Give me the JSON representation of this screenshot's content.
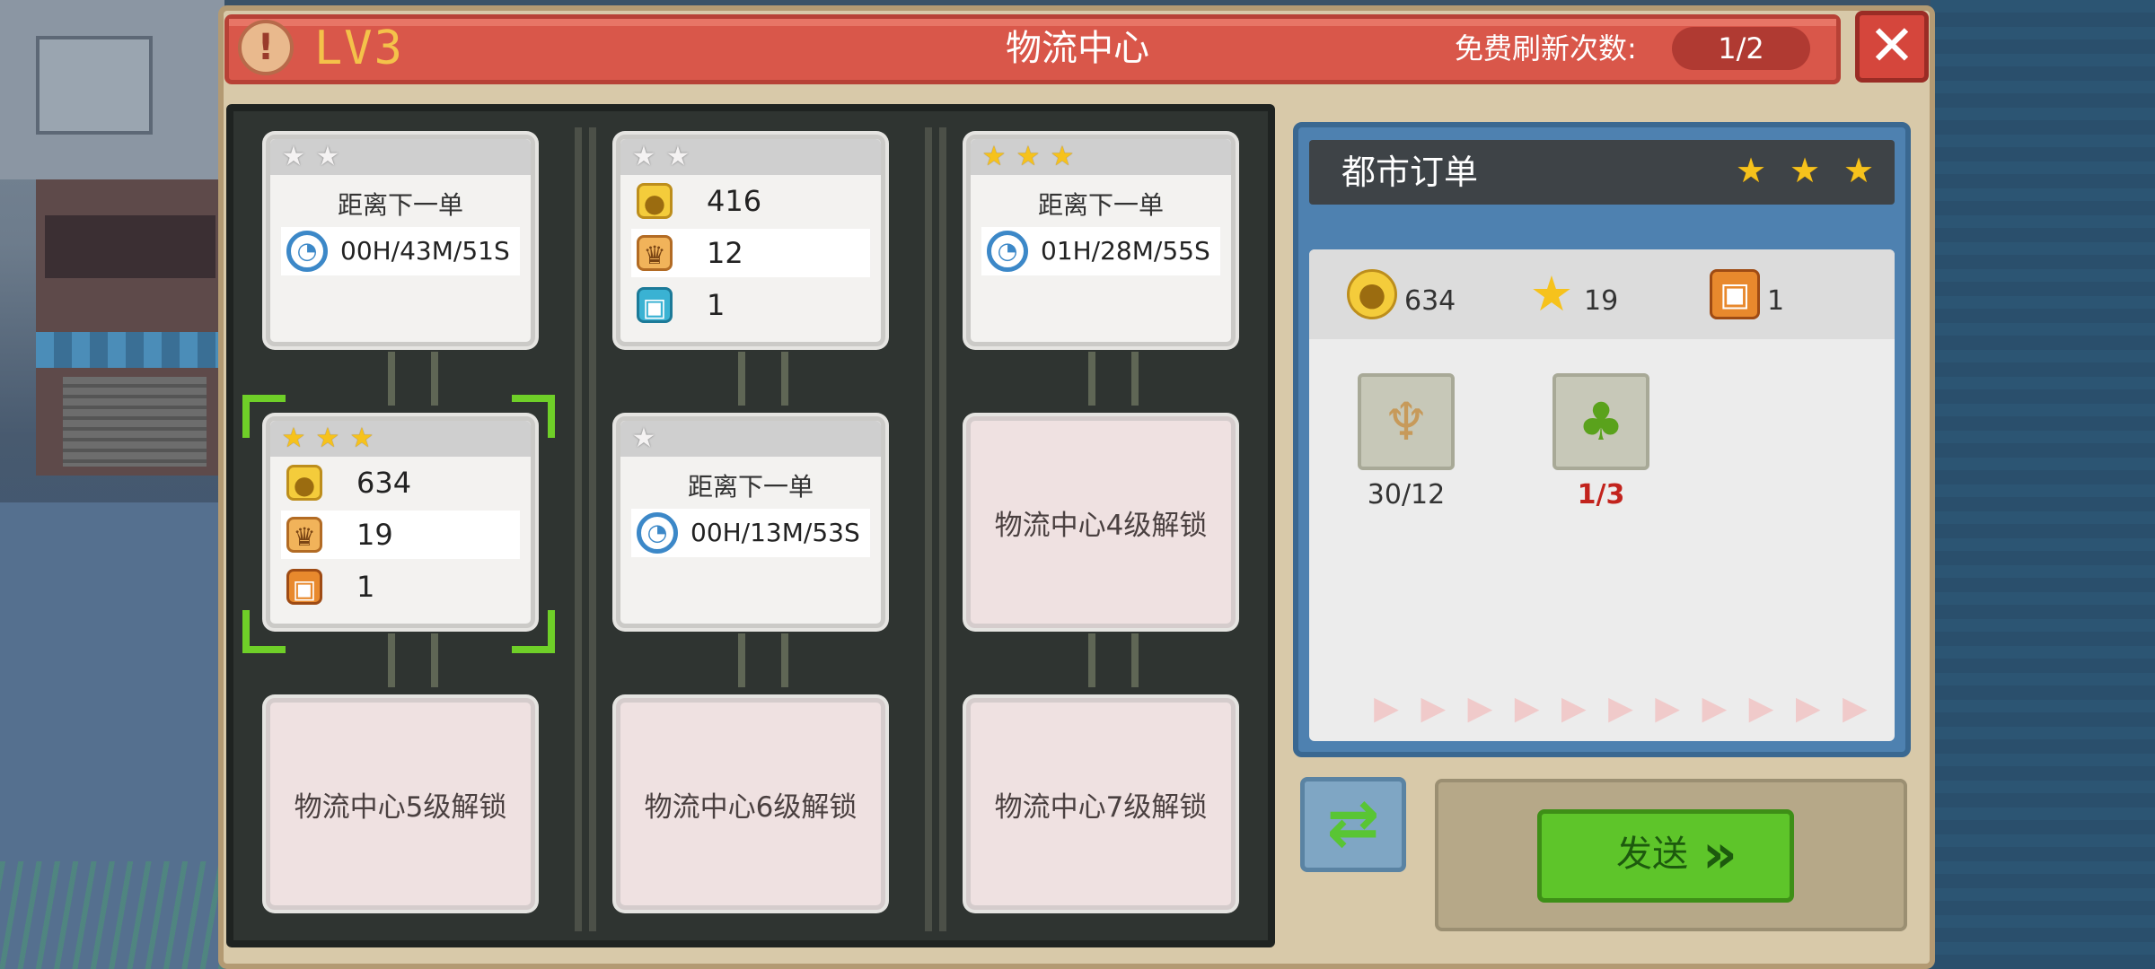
{
  "header": {
    "level": "LV3",
    "title": "物流中心",
    "refresh_label": "免费刷新次数:",
    "refresh_count": "1/2",
    "close_glyph": "✕",
    "info_glyph": "!"
  },
  "orders": [
    {
      "stars": 2,
      "max_stars": 2,
      "type": "timer",
      "label": "距离下一单",
      "time": "00H/43M/51S"
    },
    {
      "stars": 2,
      "max_stars": 2,
      "type": "reward",
      "coins": "416",
      "chef": "12",
      "box": "1",
      "box_color": "blue"
    },
    {
      "stars": 3,
      "max_stars": 3,
      "type": "timer",
      "label": "距离下一单",
      "time": "01H/28M/55S"
    },
    {
      "stars": 3,
      "max_stars": 3,
      "type": "reward",
      "coins": "634",
      "chef": "19",
      "box": "1",
      "box_color": "orange",
      "selected": true
    },
    {
      "stars": 1,
      "max_stars": 1,
      "type": "timer",
      "label": "距离下一单",
      "time": "00H/13M/53S"
    },
    {
      "type": "locked",
      "label": "物流中心4级解锁"
    },
    {
      "type": "locked",
      "label": "物流中心5级解锁"
    },
    {
      "type": "locked",
      "label": "物流中心6级解锁"
    },
    {
      "type": "locked",
      "label": "物流中心7级解锁"
    }
  ],
  "detail": {
    "title": "都市订单",
    "stars": 3,
    "rewards": {
      "coins": "634",
      "stars": "19",
      "gift": "1"
    },
    "materials": [
      {
        "icon": "wheat-icon",
        "count": "30/12",
        "sufficient": true
      },
      {
        "icon": "pear-icon",
        "count": "1/3",
        "sufficient": false
      }
    ]
  },
  "actions": {
    "send_label": "发送",
    "swap_icon": "refresh-icon"
  },
  "colors": {
    "title_bar": "#d9574a",
    "accent_green": "#5ec52a",
    "insufficient_red": "#c2231d",
    "star_gold": "#f6c21c"
  }
}
